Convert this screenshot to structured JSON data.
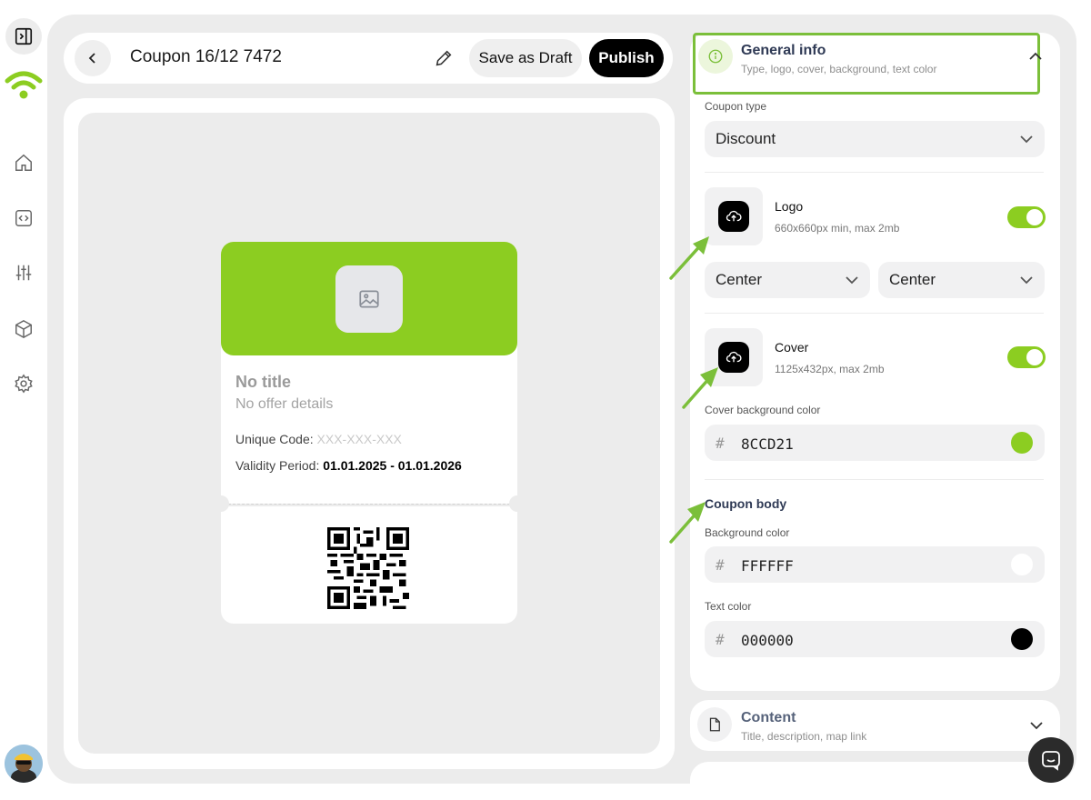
{
  "header": {
    "title": "Coupon 16/12 7472",
    "draft_label": "Save as Draft",
    "publish_label": "Publish"
  },
  "preview": {
    "title": "No title",
    "offer": "No offer details",
    "code_label": "Unique Code:",
    "code_value": "XXX-XXX-XXX",
    "validity_label": "Validity Period:",
    "validity_value": "01.01.2025 - 01.01.2026"
  },
  "general_info": {
    "title": "General info",
    "subtitle": "Type, logo, cover, background, text color",
    "coupon_type_label": "Coupon type",
    "coupon_type_value": "Discount",
    "logo": {
      "title": "Logo",
      "subtitle": "660x660px min, max 2mb",
      "enabled": true,
      "h_align": "Center",
      "v_align": "Center"
    },
    "cover": {
      "title": "Cover",
      "subtitle": "1125x432px, max 2mb",
      "enabled": true
    },
    "cover_bg_label": "Cover background color",
    "cover_bg_hash": "#",
    "cover_bg_value": "8CCD21",
    "body_title": "Coupon body",
    "body_bg_label": "Background color",
    "body_bg_hash": "#",
    "body_bg_value": "FFFFFF",
    "text_color_label": "Text color",
    "text_color_hash": "#",
    "text_color_value": "000000"
  },
  "content_section": {
    "title": "Content",
    "subtitle": "Title, description, map link"
  },
  "colors": {
    "accent": "#8ccd21",
    "cover_swatch": "#8ccd21",
    "body_swatch": "#ffffff",
    "text_swatch": "#000000",
    "highlight": "#7bbf3a"
  },
  "icons": [
    "sidebar-toggle-icon",
    "wifi-logo-icon",
    "home-icon",
    "code-icon",
    "sliders-icon",
    "box-icon",
    "settings-icon",
    "back-chevron-icon",
    "pencil-icon",
    "image-placeholder-icon",
    "info-icon",
    "chevron-up-icon",
    "chevron-down-icon",
    "cloud-upload-icon",
    "document-icon",
    "chat-icon"
  ]
}
